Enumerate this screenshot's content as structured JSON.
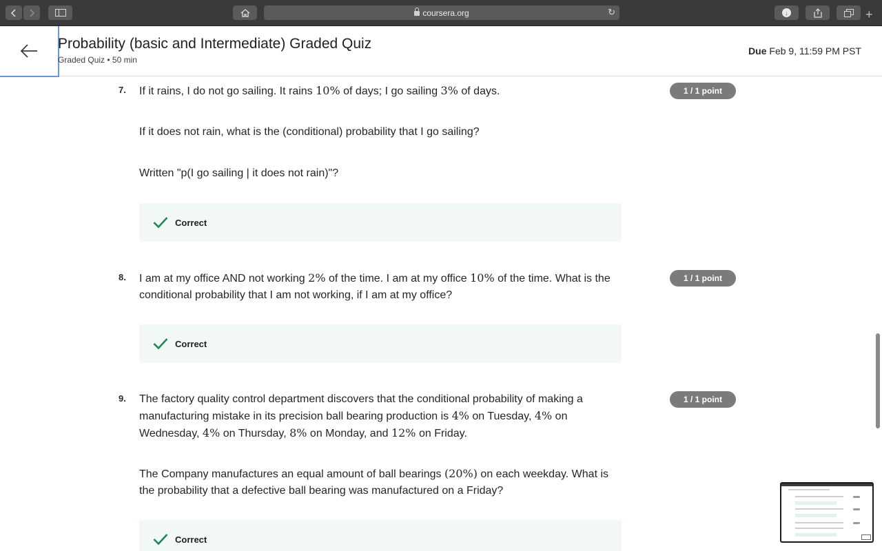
{
  "browser": {
    "url": "coursera.org",
    "back_icon": "chevron-left-icon",
    "forward_icon": "chevron-right-icon"
  },
  "header": {
    "title": "Probability (basic and Intermediate) Graded Quiz",
    "subtitle": "Graded Quiz • 50 min",
    "due_label": "Due",
    "due_value": "Feb 9, 11:59 PM PST"
  },
  "questions": [
    {
      "number": "7.",
      "score": "1 / 1 point",
      "line1_a": "If it rains, I do not go sailing. It rains ",
      "line1_m1": "10%",
      "line1_b": " of days; I go sailing ",
      "line1_m2": "3%",
      "line1_c": " of days.",
      "para2": "If it does not rain, what is the (conditional) probability that I go sailing?",
      "para3": "Written \"p(I go sailing | it does not rain)\"?",
      "feedback": "Correct"
    },
    {
      "number": "8.",
      "score": "1 / 1 point",
      "text_a": "I am at my office AND not working ",
      "text_m1": "2%",
      "text_b": " of the time. I am at my office ",
      "text_m2": "10%",
      "text_c": " of the time. What is the conditional probability that I am not working, if I am at my office?",
      "feedback": "Correct"
    },
    {
      "number": "9.",
      "score": "1 / 1 point",
      "text_a": "The factory quality control department discovers that the conditional probability of making a manufacturing mistake in its precision ball bearing production is ",
      "m1": "4%",
      "text_b": " on Tuesday, ",
      "m2": "4%",
      "text_c": " on Wednesday, ",
      "m3": "4%",
      "text_d": " on Thursday, ",
      "m4": "8%",
      "text_e": " on Monday, and ",
      "m5": "12%",
      "text_f": " on Friday.",
      "para2_a": "The Company manufactures an equal amount of ball bearings ",
      "para2_m": "(20%)",
      "para2_b": " on each weekday. What is the probability that a defective ball bearing was manufactured on a Friday?",
      "feedback": "Correct"
    }
  ],
  "colors": {
    "check": "#1f8354",
    "feedback_bg": "#f2f8f6",
    "pill_bg": "#7b7b7b",
    "focus_border": "#6b97d8"
  }
}
